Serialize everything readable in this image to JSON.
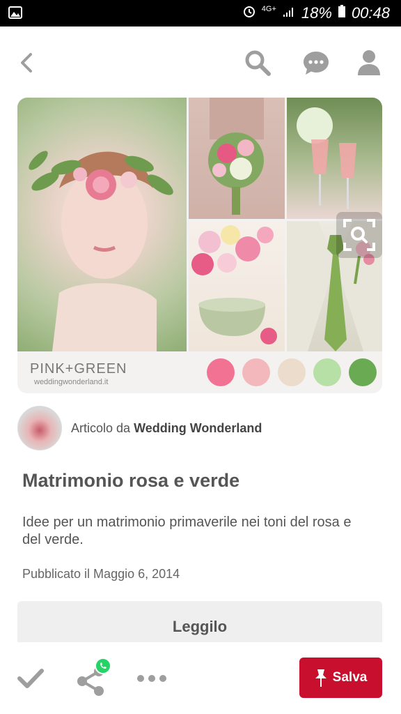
{
  "status_bar": {
    "network": "4G+",
    "battery": "18%",
    "time": "00:48"
  },
  "nav": {
    "icons": [
      "back-icon",
      "search-icon",
      "chat-icon",
      "profile-icon"
    ]
  },
  "pin": {
    "palette_title": "PINK+GREEN",
    "palette_site": "weddingwonderland.it",
    "palette_colors": [
      "#f27294",
      "#f2b8bc",
      "#ecdccb",
      "#b6e0a6",
      "#6aaa52"
    ],
    "attribution_prefix": "Articolo da",
    "attribution_source": "Wedding Wonderland",
    "title": "Matrimonio rosa e verde",
    "description": "Idee per un matrimonio primaverile nei toni del rosa e del verde.",
    "published": "Pubblicato il Maggio 6, 2014",
    "read_button": "Leggilo"
  },
  "bottom_bar": {
    "save_label": "Salva"
  },
  "colors": {
    "save_red": "#c8102e",
    "icon_gray": "#9e9e9e"
  }
}
